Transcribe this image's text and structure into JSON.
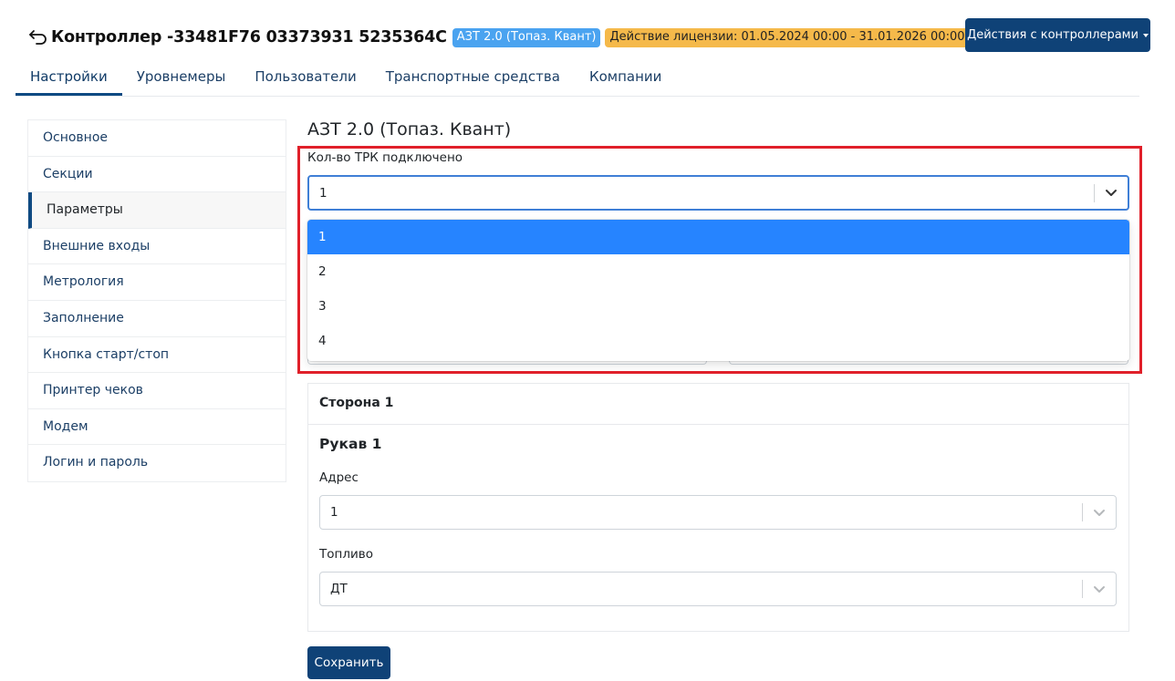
{
  "header": {
    "title": "Контроллер -33481F76 03373931 5235364C",
    "type_badge": "АЗТ 2.0 (Топаз. Квант)",
    "license_badge": "Действие лицензии: 01.05.2024 00:00 - 31.01.2026 00:00",
    "actions_button": "Действия с контроллерами",
    "back_icon": "arrow-back-icon"
  },
  "tabs": [
    {
      "label": "Настройки",
      "active": true
    },
    {
      "label": "Уровнемеры",
      "active": false
    },
    {
      "label": "Пользователи",
      "active": false
    },
    {
      "label": "Транспортные средства",
      "active": false
    },
    {
      "label": "Компании",
      "active": false
    }
  ],
  "sidebar": {
    "items": [
      {
        "label": "Основное",
        "active": false
      },
      {
        "label": "Секции",
        "active": false
      },
      {
        "label": "Параметры",
        "active": true
      },
      {
        "label": "Внешние входы",
        "active": false
      },
      {
        "label": "Метрология",
        "active": false
      },
      {
        "label": "Заполнение",
        "active": false
      },
      {
        "label": "Кнопка старт/стоп",
        "active": false
      },
      {
        "label": "Принтер чеков",
        "active": false
      },
      {
        "label": "Модем",
        "active": false
      },
      {
        "label": "Логин и пароль",
        "active": false
      }
    ]
  },
  "main": {
    "section_title": "АЗТ 2.0 (Топаз. Квант)",
    "trk_count": {
      "label": "Кол-во ТРК подключено",
      "value": "1",
      "options": [
        "1",
        "2",
        "3",
        "4"
      ],
      "selected": "1"
    },
    "card": {
      "header": "Сторона 1",
      "sub_title": "Рукав 1",
      "address_label": "Адрес",
      "address_value": "1",
      "fuel_label": "Топливо",
      "fuel_value": "ДТ"
    },
    "save_button": "Сохранить"
  },
  "colors": {
    "primary": "#0f4277",
    "badge_type": "#4aa3f0",
    "badge_license": "#f5b94a",
    "option_selected": "#2684ff",
    "highlight": "#e0202a"
  }
}
